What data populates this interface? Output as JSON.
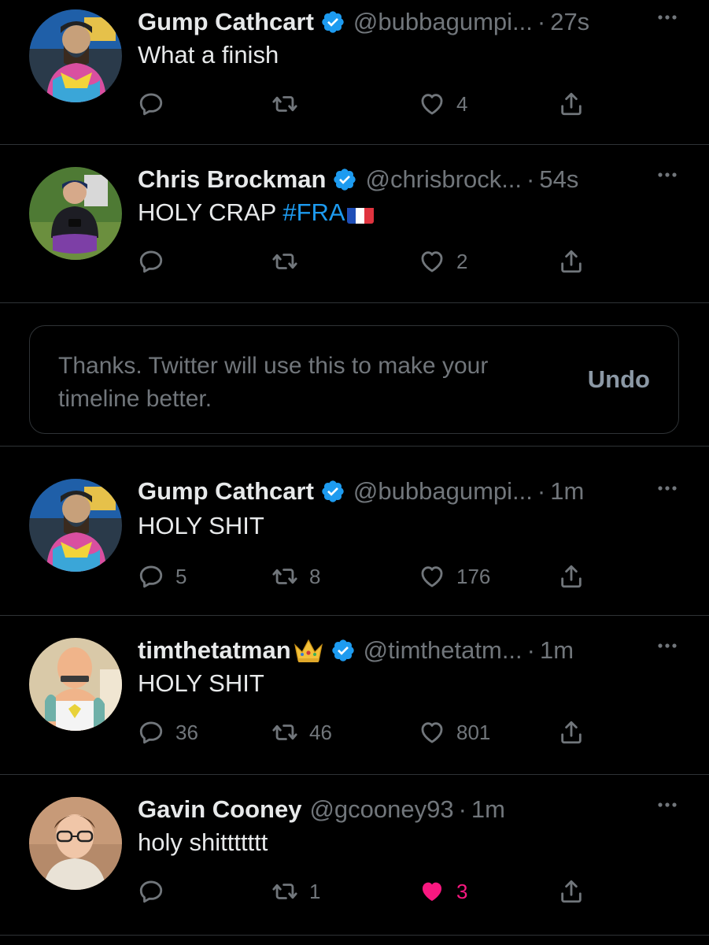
{
  "colors": {
    "background": "#000000",
    "primary_text": "#e7e9ea",
    "secondary_text": "#71767b",
    "accent": "#1d9bf0",
    "like_active": "#f91880"
  },
  "tweets": [
    {
      "name": "Gump Cathcart",
      "verified": true,
      "handle": "@bubbagumpi...",
      "separator": "·",
      "time": "27s",
      "text": "What a finish",
      "replies": "",
      "retweets": "",
      "likes": "4",
      "liked": false
    },
    {
      "name": "Chris Brockman",
      "verified": true,
      "handle": "@chrisbrock...",
      "separator": "·",
      "time": "54s",
      "text": "HOLY CRAP ",
      "hashtag": "#FRA",
      "flag": "france-flag-icon",
      "replies": "",
      "retweets": "",
      "likes": "2",
      "liked": false
    },
    {
      "name": "Gump Cathcart",
      "verified": true,
      "handle": "@bubbagumpi...",
      "separator": "·",
      "time": "1m",
      "text": "HOLY SHIT",
      "replies": "5",
      "retweets": "8",
      "likes": "176",
      "liked": false
    },
    {
      "name": "timthetatman",
      "crown": "crown-icon",
      "verified": true,
      "handle": "@timthetatm...",
      "separator": "·",
      "time": "1m",
      "text": "HOLY SHIT",
      "replies": "36",
      "retweets": "46",
      "likes": "801",
      "liked": false
    },
    {
      "name": "Gavin Cooney",
      "verified": false,
      "handle": "@gcooney93",
      "separator": "·",
      "time": "1m",
      "text": "holy shittttttt",
      "replies": "",
      "retweets": "1",
      "likes": "3",
      "liked": true
    }
  ],
  "feedback_toast": {
    "message": "Thanks. Twitter will use this to make your timeline better.",
    "undo_label": "Undo"
  }
}
